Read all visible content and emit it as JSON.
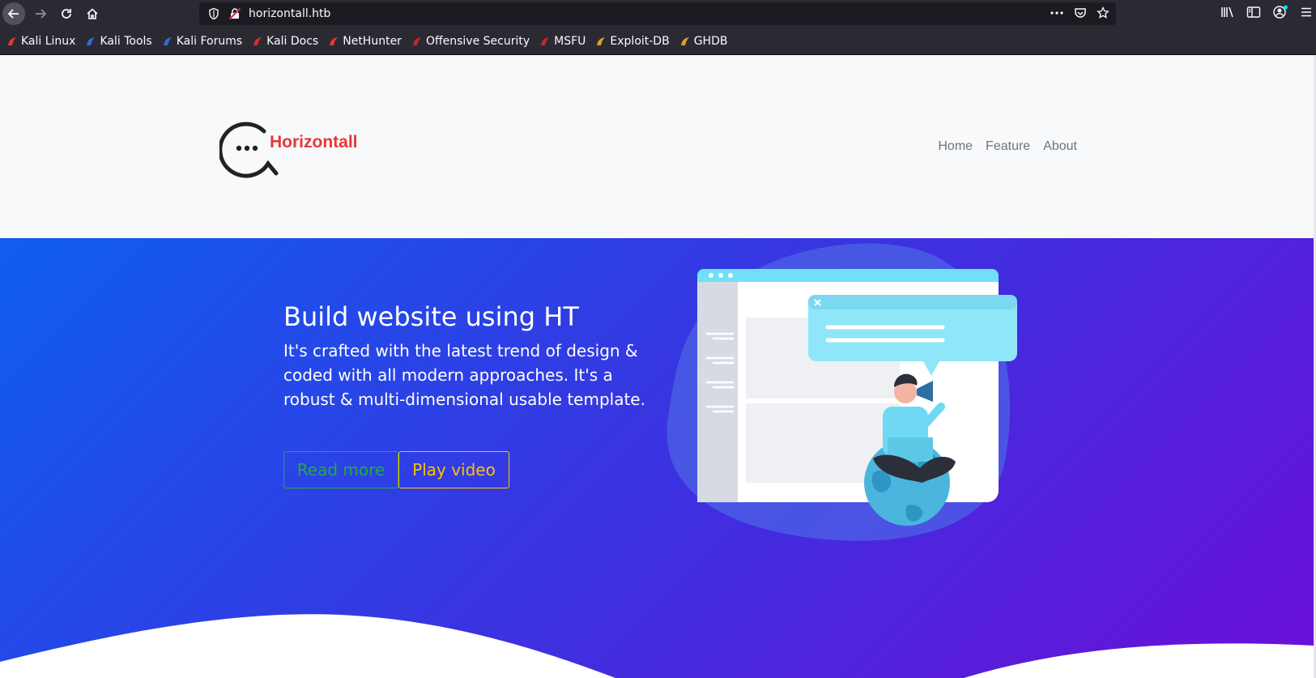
{
  "browser": {
    "url": "horizontall.htb",
    "bookmarks": [
      {
        "label": "Kali Linux",
        "icon": "kali-dragon-icon",
        "color": "#e53935"
      },
      {
        "label": "Kali Tools",
        "icon": "kali-tools-icon",
        "color": "#2f6fd8"
      },
      {
        "label": "Kali Forums",
        "icon": "kali-forums-icon",
        "color": "#2f6fd8"
      },
      {
        "label": "Kali Docs",
        "icon": "kali-docs-icon",
        "color": "#d32f2f"
      },
      {
        "label": "NetHunter",
        "icon": "nethunter-icon",
        "color": "#e53935"
      },
      {
        "label": "Offensive Security",
        "icon": "offsec-icon",
        "color": "#c62828"
      },
      {
        "label": "MSFU",
        "icon": "msfu-icon",
        "color": "#c62828"
      },
      {
        "label": "Exploit-DB",
        "icon": "exploit-db-icon",
        "color": "#e69a2e"
      },
      {
        "label": "GHDB",
        "icon": "ghdb-icon",
        "color": "#e69a2e"
      }
    ]
  },
  "site": {
    "logo_text": "Horizontall",
    "nav": [
      "Home",
      "Feature",
      "About"
    ]
  },
  "hero": {
    "title": "Build website using HT",
    "description": "It's crafted with the latest trend of design & coded with all modern approaches. It's a robust & multi-dimensional usable template.",
    "read_more_label": "Read more",
    "play_video_label": "Play video"
  },
  "colors": {
    "logo": "#e5383b",
    "header_bg": "#f8f9fa",
    "hero_gradient_start": "#0f5ef0",
    "hero_gradient_end": "#6b0fd8",
    "read_more": "#28a745",
    "play_video": "#ffc107"
  }
}
